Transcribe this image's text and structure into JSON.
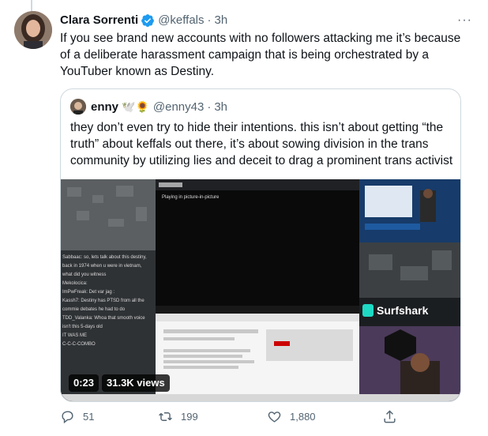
{
  "tweet": {
    "display_name": "Clara Sorrenti",
    "handle": "@keffals",
    "separator": "·",
    "time": "3h",
    "more_label": "···",
    "text": "If you see brand new accounts with no followers attacking me it’s because of a deliberate harassment campaign that is being orchestrated by a YouTuber known as Destiny."
  },
  "quote": {
    "display_name": "enny",
    "emojis": "🕊️🌻",
    "handle": "@enny43",
    "separator": "·",
    "time": "3h",
    "text": "they don’t even try to hide their intentions. this isn’t about getting “the truth” about keffals out there, it’s about sowing division in the trans community by utilizing lies and deceit to drag a prominent trans activist",
    "video": {
      "duration": "0:23",
      "views": "31.3K views",
      "pip_text": "Playing in picture-in-picture",
      "sponsor": "Surfshark",
      "chat_lines": [
        "Sabbaac: so, lets talk about this destiny,",
        "back in 1974 when u were in vietnam,",
        "what did you witness",
        "Mekolocica: ",
        "ImPwFreak: Det var jag :",
        "Kassh7: Destiny has PTSD from all the",
        "commie debates he had to do",
        "TDD_Valanka: Whoa that smooth voice",
        "isn't this 5-days old",
        "IT WAS ME",
        "C-C-C-COMBO"
      ]
    }
  },
  "actions": {
    "replies": "51",
    "retweets": "199",
    "likes": "1,880",
    "share": ""
  },
  "colors": {
    "text": "#0f1419",
    "muted": "#536471",
    "verified": "#1d9bf0",
    "border": "#cfd9de"
  }
}
